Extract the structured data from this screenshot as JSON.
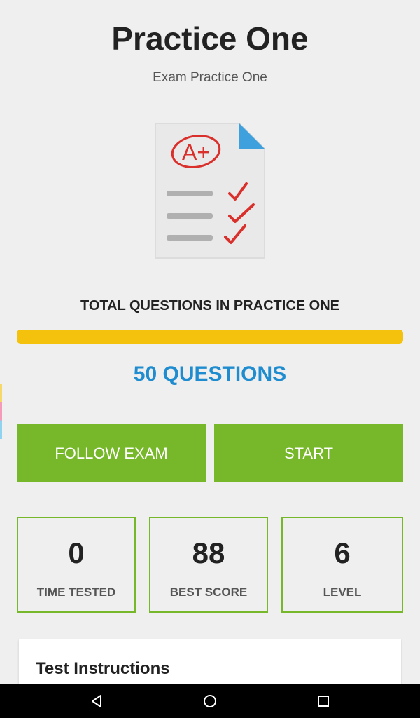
{
  "header": {
    "title": "Practice One",
    "subtitle": "Exam Practice One"
  },
  "illustration": {
    "icon": "exam-document-icon",
    "grade_text": "A+",
    "grade_color": "#d9302c",
    "fold_color": "#3ea0dc"
  },
  "questions": {
    "total_label": "TOTAL QUESTIONS IN PRACTICE ONE",
    "progress_fraction": 1.0,
    "progress_color": "#f4c20d",
    "count_text": "50 QUESTIONS",
    "count_color": "#1f8ccf"
  },
  "actions": {
    "follow_label": "FOLLOW EXAM",
    "start_label": "START",
    "button_color": "#76b82a"
  },
  "stats": [
    {
      "value": "0",
      "label": "TIME TESTED"
    },
    {
      "value": "88",
      "label": "BEST SCORE"
    },
    {
      "value": "6",
      "label": "LEVEL"
    }
  ],
  "instructions": {
    "title": "Test Instructions"
  },
  "system_nav": {
    "back_icon": "triangle-back-icon",
    "home_icon": "circle-home-icon",
    "recent_icon": "square-recent-icon"
  }
}
